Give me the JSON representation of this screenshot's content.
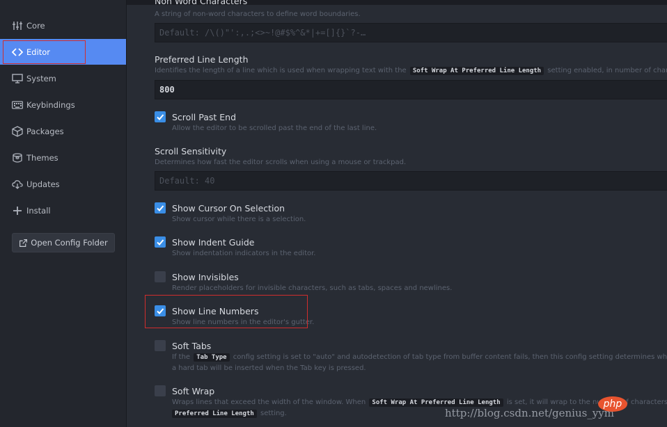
{
  "sidebar": {
    "items": [
      {
        "label": "Core",
        "icon": "sliders-icon",
        "active": false
      },
      {
        "label": "Editor",
        "icon": "code-icon",
        "active": true
      },
      {
        "label": "System",
        "icon": "monitor-icon",
        "active": false
      },
      {
        "label": "Keybindings",
        "icon": "keyboard-icon",
        "active": false
      },
      {
        "label": "Packages",
        "icon": "package-icon",
        "active": false
      },
      {
        "label": "Themes",
        "icon": "paintcan-icon",
        "active": false
      },
      {
        "label": "Updates",
        "icon": "cloud-download-icon",
        "active": false
      },
      {
        "label": "Install",
        "icon": "plus-icon",
        "active": false
      }
    ],
    "open_config_label": "Open Config Folder"
  },
  "settings": {
    "non_word": {
      "title": "Non Word Characters",
      "desc": "A string of non-word characters to define word boundaries.",
      "placeholder": "Default: /\\()\"':,.;<>~!@#$%^&*|+=[]{}`?-…"
    },
    "line_length": {
      "title": "Preferred Line Length",
      "desc_before": "Identifies the length of a line which is used when wrapping text with the",
      "desc_code": "Soft Wrap At Preferred Line Length",
      "desc_after": "setting enabled, in number of characters.",
      "value": "800"
    },
    "scroll_past_end": {
      "title": "Scroll Past End",
      "desc": "Allow the editor to be scrolled past the end of the last line.",
      "checked": true
    },
    "scroll_sensitivity": {
      "title": "Scroll Sensitivity",
      "desc": "Determines how fast the editor scrolls when using a mouse or trackpad.",
      "placeholder": "Default: 40"
    },
    "show_cursor_on_selection": {
      "title": "Show Cursor On Selection",
      "desc": "Show cursor while there is a selection.",
      "checked": true
    },
    "show_indent_guide": {
      "title": "Show Indent Guide",
      "desc": "Show indentation indicators in the editor.",
      "checked": true
    },
    "show_invisibles": {
      "title": "Show Invisibles",
      "desc": "Render placeholders for invisible characters, such as tabs, spaces and newlines.",
      "checked": false
    },
    "show_line_numbers": {
      "title": "Show Line Numbers",
      "desc": "Show line numbers in the editor's gutter.",
      "checked": true
    },
    "soft_tabs": {
      "title": "Soft Tabs",
      "desc_before": "If the",
      "desc_code": "Tab Type",
      "desc_after": "config setting is set to \"auto\" and autodetection of tab type from buffer content fails, then this config setting determines whether a soft tab or",
      "desc_line2": "a hard tab will be inserted when the Tab key is pressed.",
      "checked": false
    },
    "soft_wrap": {
      "title": "Soft Wrap",
      "desc_before": "Wraps lines that exceed the width of the window. When",
      "desc_code": "Soft Wrap At Preferred Line Length",
      "desc_after": "is set, it will wrap to the number of characters defined by the",
      "desc_code2": "Preferred Line Length",
      "desc_after2": "setting.",
      "checked": false
    }
  },
  "watermark": {
    "text": "http://blog.csdn.net/genius_yym",
    "badge": "php"
  },
  "colors": {
    "accent": "#568af2",
    "checkbox_on": "#3a8ee6",
    "highlight_box": "#d12d2d"
  }
}
